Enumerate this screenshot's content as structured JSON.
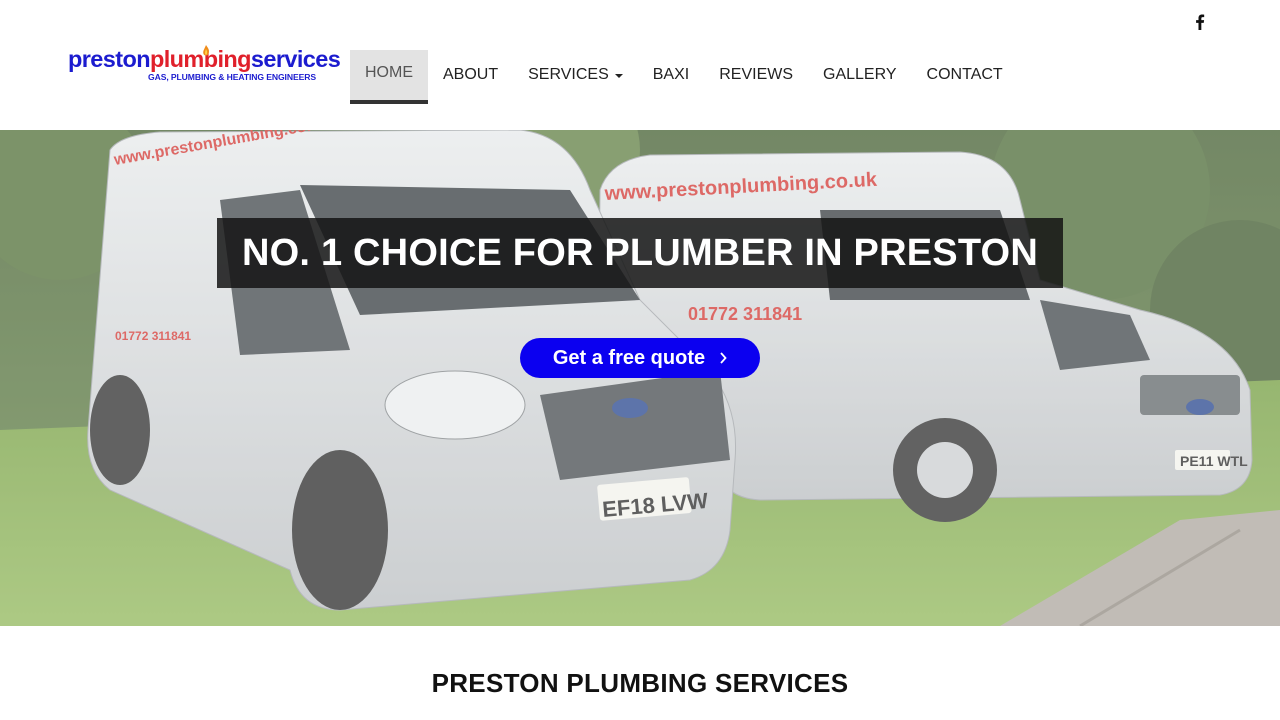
{
  "header": {
    "social": {
      "icon": "facebook-icon"
    },
    "logo": {
      "part1": "preston",
      "part2": "plumbing",
      "part3": "services",
      "tagline": "GAS, PLUMBING & HEATING ENGINEERS",
      "colors": {
        "blue": "#1c1ccf",
        "red": "#e0202b"
      }
    },
    "nav": {
      "home": "HOME",
      "about": "ABOUT",
      "services": "SERVICES",
      "baxi": "BAXI",
      "reviews": "REVIEWS",
      "gallery": "GALLERY",
      "contact": "CONTACT"
    }
  },
  "hero": {
    "title": "NO. 1 CHOICE FOR PLUMBER IN PRESTON",
    "button_label": "Get a free quote",
    "button_color": "#0b00f0",
    "image_text": {
      "website": "www.prestonplumbing.co.uk",
      "phone": "01772 311841",
      "plate_left": "EF18 LVW",
      "plate_right": "PE11 WTL"
    }
  },
  "main": {
    "heading": "PRESTON PLUMBING SERVICES"
  }
}
